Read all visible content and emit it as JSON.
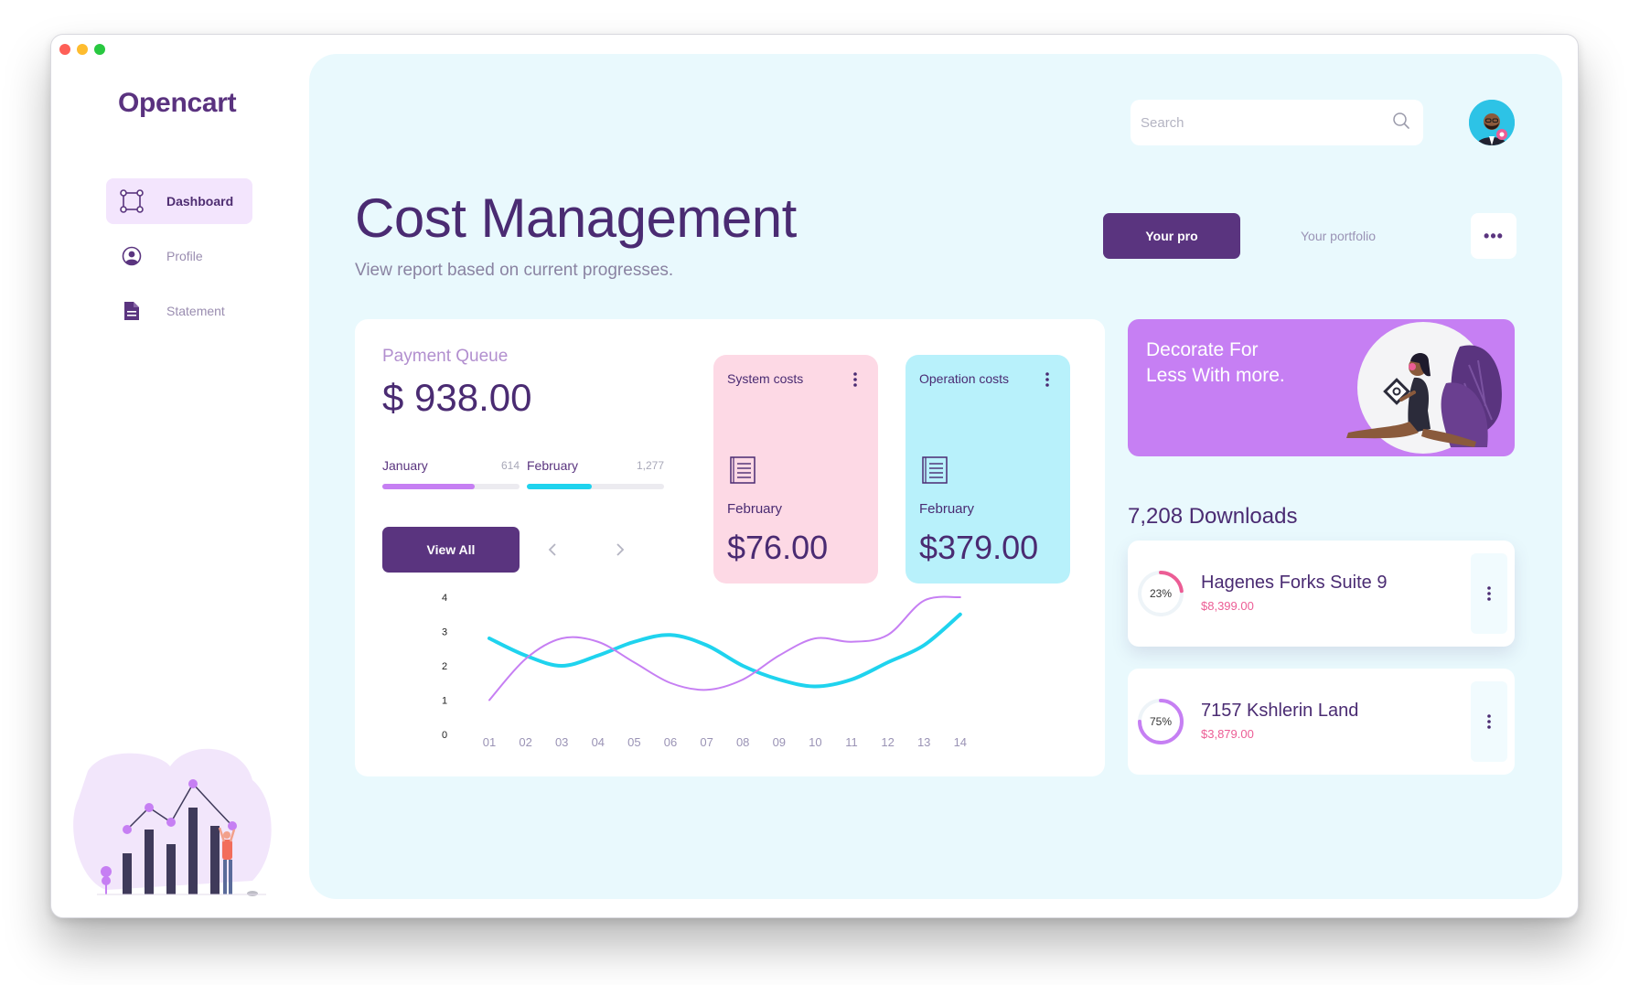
{
  "app": {
    "logo": "Opencart"
  },
  "sidebar": {
    "items": [
      {
        "label": "Dashboard",
        "icon": "dashboard-icon",
        "active": true
      },
      {
        "label": "Profile",
        "icon": "profile-icon",
        "active": false
      },
      {
        "label": "Statement",
        "icon": "statement-icon",
        "active": false
      }
    ]
  },
  "header": {
    "search_placeholder": "Search",
    "title": "Cost Management",
    "subtitle": "View report based on current progresses.",
    "tabs": {
      "primary": "Your pro",
      "secondary": "Your portfolio",
      "more": "•••"
    }
  },
  "payment_queue": {
    "label": "Payment Queue",
    "amount": "$ 938.00",
    "months": [
      {
        "name": "January",
        "count": "614",
        "progress": 0.67,
        "color": "#c67ff3"
      },
      {
        "name": "February",
        "count": "1,277",
        "progress": 0.47,
        "color": "#1fd3ee"
      }
    ],
    "view_all": "View All"
  },
  "cost_cards": [
    {
      "title": "System costs",
      "month": "February",
      "amount": "$76.00",
      "bg": "#fdd9e5"
    },
    {
      "title": "Operation costs",
      "month": "February",
      "amount": "$379.00",
      "bg": "#b8f1fb"
    }
  ],
  "chart_data": {
    "type": "line",
    "x": [
      "01",
      "02",
      "03",
      "04",
      "05",
      "06",
      "07",
      "08",
      "09",
      "10",
      "11",
      "12",
      "13",
      "14"
    ],
    "ylim": [
      0,
      4
    ],
    "yticks": [
      "0",
      "1",
      "2",
      "3",
      "4"
    ],
    "series": [
      {
        "color": "#1fd3ee",
        "values": [
          2.8,
          2.3,
          2.0,
          2.3,
          2.7,
          2.9,
          2.6,
          2.0,
          1.6,
          1.4,
          1.6,
          2.1,
          2.6,
          3.5
        ]
      },
      {
        "color": "#c67ff3",
        "values": [
          1.0,
          2.2,
          2.8,
          2.7,
          2.1,
          1.5,
          1.3,
          1.6,
          2.3,
          2.8,
          2.7,
          2.9,
          3.9,
          4.0
        ]
      }
    ]
  },
  "promo": {
    "line1": "Decorate For",
    "line2": "Less With more."
  },
  "downloads": {
    "title": "7,208 Downloads",
    "items": [
      {
        "name": "Hagenes Forks Suite 9",
        "price": "$8,399.00",
        "percent_label": "23%",
        "percent": 0.23,
        "color": "#ec5d95"
      },
      {
        "name": "7157 Kshlerin Land",
        "price": "$3,879.00",
        "percent_label": "75%",
        "percent": 0.75,
        "color": "#c67ff3"
      }
    ]
  }
}
